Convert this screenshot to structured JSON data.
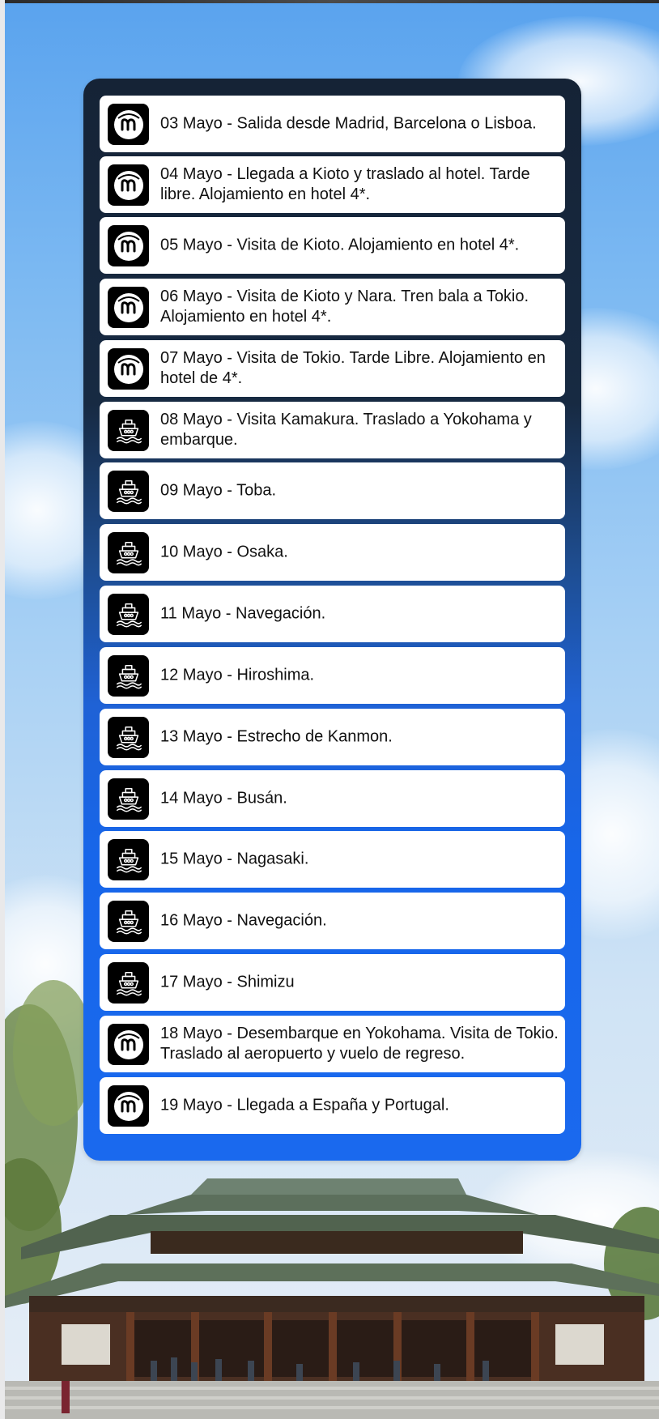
{
  "colors": {
    "panel_top": "#152336",
    "panel_bottom": "#1a69ee",
    "row_bg": "#ffffff",
    "icon_bg": "#000000"
  },
  "itinerary": [
    {
      "icon": "brand-logo-icon",
      "text": "03 Mayo - Salida desde Madrid, Barcelona o Lisboa."
    },
    {
      "icon": "brand-logo-icon",
      "text": "04 Mayo - Llegada a Kioto y traslado al hotel. Tarde libre. Alojamiento en hotel 4*."
    },
    {
      "icon": "brand-logo-icon",
      "text": "05 Mayo - Visita de Kioto. Alojamiento en hotel 4*."
    },
    {
      "icon": "brand-logo-icon",
      "text": "06 Mayo - Visita de Kioto y Nara. Tren bala a Tokio. Alojamiento en hotel 4*."
    },
    {
      "icon": "brand-logo-icon",
      "text": "07 Mayo - Visita de Tokio. Tarde Libre. Alojamiento en hotel de 4*."
    },
    {
      "icon": "cruise-ship-icon",
      "text": "08 Mayo - Visita Kamakura. Traslado a Yokohama y embarque."
    },
    {
      "icon": "cruise-ship-icon",
      "text": "09 Mayo - Toba."
    },
    {
      "icon": "cruise-ship-icon",
      "text": "10 Mayo - Osaka."
    },
    {
      "icon": "cruise-ship-icon",
      "text": "11 Mayo - Navegación."
    },
    {
      "icon": "cruise-ship-icon",
      "text": "12 Mayo - Hiroshima."
    },
    {
      "icon": "cruise-ship-icon",
      "text": "13 Mayo - Estrecho de Kanmon."
    },
    {
      "icon": "cruise-ship-icon",
      "text": "14 Mayo - Busán."
    },
    {
      "icon": "cruise-ship-icon",
      "text": "15 Mayo - Nagasaki."
    },
    {
      "icon": "cruise-ship-icon",
      "text": "16 Mayo - Navegación."
    },
    {
      "icon": "cruise-ship-icon",
      "text": "17 Mayo - Shimizu"
    },
    {
      "icon": "brand-logo-icon",
      "text": "18 Mayo - Desembarque en Yokohama. Visita de Tokio. Traslado al aeropuerto y vuelo de regreso."
    },
    {
      "icon": "brand-logo-icon",
      "text": "19 Mayo - Llegada a España y Portugal."
    }
  ]
}
